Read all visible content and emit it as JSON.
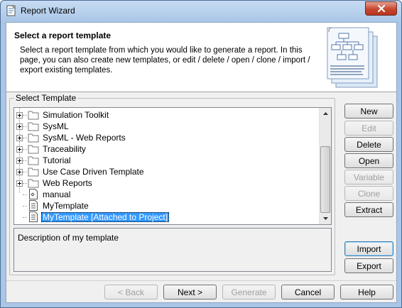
{
  "window": {
    "title": "Report Wizard"
  },
  "header": {
    "title": "Select a report template",
    "description": "Select a report template from which you would like to generate a report. In this page, you can also create new templates, or edit / delete / open / clone / import / export existing templates."
  },
  "template_group": {
    "title": "Select Template",
    "tree_items": [
      {
        "label": "Simulation Toolkit",
        "kind": "folder"
      },
      {
        "label": "SysML",
        "kind": "folder"
      },
      {
        "label": "SysML - Web Reports",
        "kind": "folder"
      },
      {
        "label": "Traceability",
        "kind": "folder"
      },
      {
        "label": "Tutorial",
        "kind": "folder"
      },
      {
        "label": "Use Case Driven Template",
        "kind": "folder"
      },
      {
        "label": "Web Reports",
        "kind": "folder"
      },
      {
        "label": "manual",
        "kind": "doc-special"
      },
      {
        "label": "MyTemplate",
        "kind": "doc"
      },
      {
        "label": "MyTemplate [Attached to Project]",
        "kind": "doc",
        "selected": true
      }
    ],
    "description": "Description of my template"
  },
  "side_buttons": {
    "new": "New",
    "edit": "Edit",
    "delete": "Delete",
    "open": "Open",
    "variable": "Variable",
    "clone": "Clone",
    "extract": "Extract",
    "import": "Import",
    "export": "Export"
  },
  "nav_buttons": {
    "back": "< Back",
    "next": "Next >",
    "generate": "Generate",
    "cancel": "Cancel",
    "help": "Help"
  },
  "colors": {
    "selection": "#3399ff",
    "close_button": "#c7462f",
    "title_bar": "#a9c6e6"
  }
}
